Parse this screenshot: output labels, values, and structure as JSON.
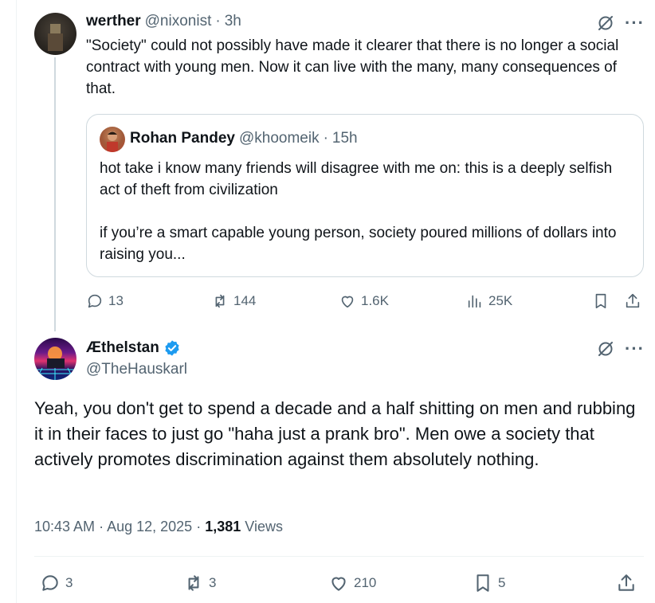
{
  "reply_tweet": {
    "author_name": "werther",
    "author_handle": "@nixonist",
    "separator": "·",
    "timestamp": "3h",
    "text": "\"Society\" could not possibly have made it clearer that there is no longer a social contract with young men. Now it can live with the many, many consequences of that.",
    "quote": {
      "author_name": "Rohan Pandey",
      "author_handle": "@khoomeik",
      "timestamp": "15h",
      "text_p1": "hot take i know many friends will disagree with me on: this is a deeply selfish act of theft from civilization",
      "text_p2": "if you’re a smart capable young person, society poured millions of dollars into raising you..."
    },
    "actions": {
      "replies": "13",
      "reposts": "144",
      "likes": "1.6K",
      "views": "25K"
    }
  },
  "main_tweet": {
    "author_name": "Æthelstan",
    "author_handle": "@TheHauskarl",
    "verified": true,
    "text": "Yeah, you don't get to spend a decade and a half shitting on men and rubbing it in their faces to just go \"haha just a prank bro\". Men owe a society that actively promotes discrimination against them absolutely nothing.",
    "time": "10:43 AM",
    "separator": "·",
    "date": "Aug 12, 2025",
    "views_count": "1,381",
    "views_label": "Views",
    "actions": {
      "replies": "3",
      "reposts": "3",
      "likes": "210",
      "bookmarks": "5"
    }
  },
  "colors": {
    "text_primary": "#0f1419",
    "text_secondary": "#536471",
    "border": "#cfd9de",
    "verified_blue": "#1d9bf0"
  }
}
